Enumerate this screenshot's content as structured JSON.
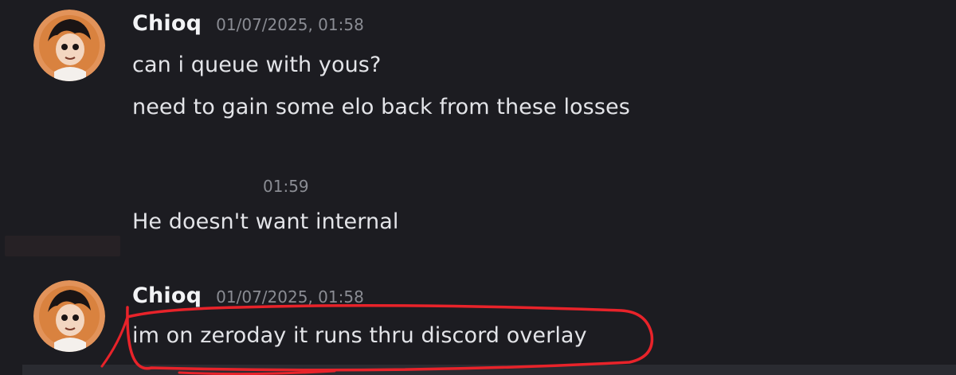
{
  "messages": [
    {
      "username": "Chioq",
      "timestamp": "01/07/2025, 01:58",
      "lines": [
        "can i queue with yous?",
        "need to gain some elo back from these losses"
      ]
    },
    {
      "username": "",
      "timestamp": "01:59",
      "lines": [
        "He doesn't want internal"
      ]
    },
    {
      "username": "Chioq",
      "timestamp": "01/07/2025, 01:58",
      "lines": [
        "im on zeroday it runs thru discord overlay"
      ]
    }
  ],
  "colors": {
    "background": "#1c1c21",
    "username": "#f2f3f5",
    "message_text": "#e3e4e8",
    "timestamp": "#8a8c93",
    "annotation": "#e8232a",
    "avatar_bg": "#e2935a"
  },
  "icons": {
    "avatar": "cartoon-character-avatar"
  }
}
